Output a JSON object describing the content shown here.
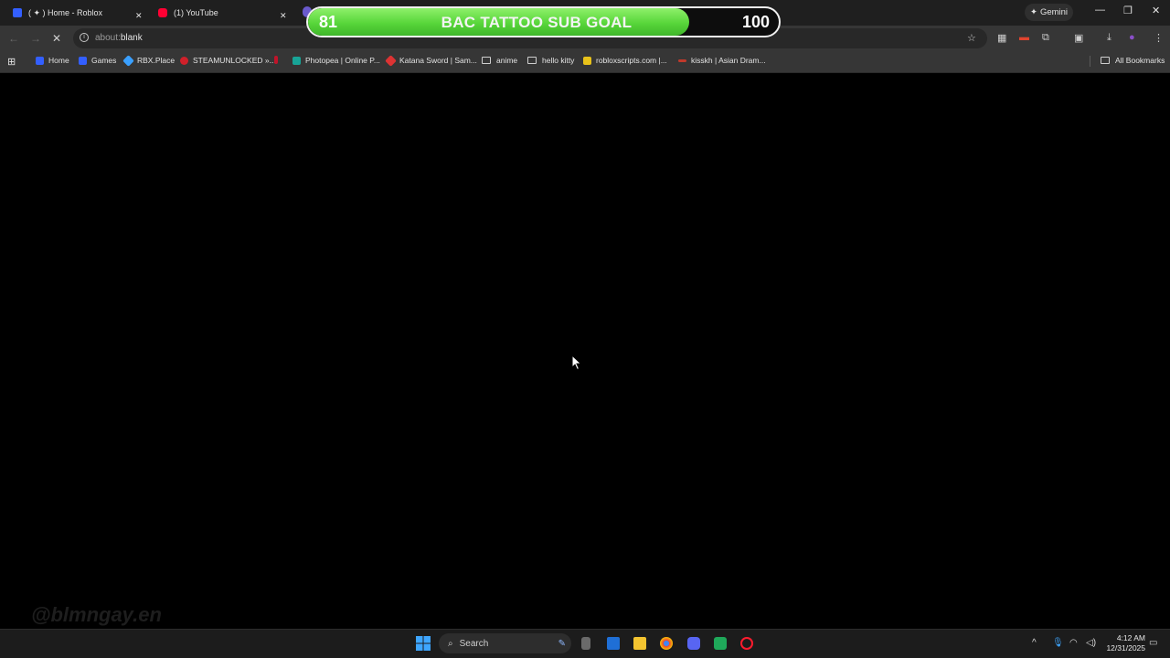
{
  "tabs": [
    {
      "label": "( ✦ ) Home - Roblox"
    },
    {
      "label": "(1) YouTube"
    }
  ],
  "gemini_label": "Gemini",
  "address": {
    "scheme": "about:",
    "value": "blank"
  },
  "bookmarks": [
    {
      "label": "Home"
    },
    {
      "label": "Games"
    },
    {
      "label": "RBX.Place"
    },
    {
      "label": "STEAMUNLOCKED »..."
    },
    {
      "label": "Photopea | Online P..."
    },
    {
      "label": "Katana Sword | Sam..."
    },
    {
      "label": "anime"
    },
    {
      "label": "hello kitty"
    },
    {
      "label": "robloxscripts.com |..."
    },
    {
      "label": "kisskh | Asian Dram..."
    }
  ],
  "all_bookmarks": "All Bookmarks",
  "sub_goal": {
    "current": "81",
    "title": "BAC TATTOO SUB GOAL",
    "target": "100",
    "progress": 0.81
  },
  "watermark": "@blmngay.en",
  "taskbar": {
    "search_label": "Search"
  },
  "clock": {
    "time": "4:12 AM",
    "date": "12/31/2025"
  },
  "colors": {
    "goal_green": "#58d63a",
    "tab_strip": "#1f1f1f",
    "toolbar": "#363636"
  }
}
